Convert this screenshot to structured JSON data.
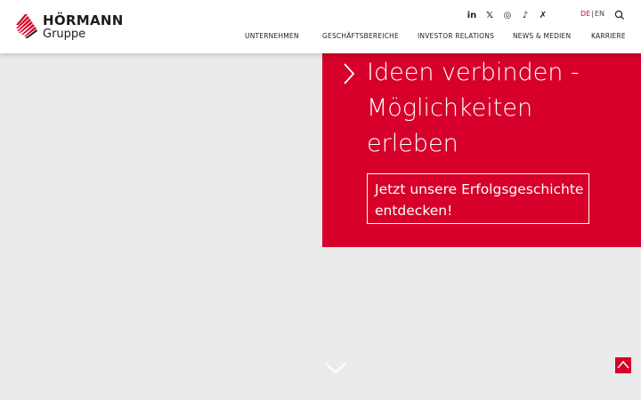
{
  "brand": {
    "name": "HÖRMANN",
    "sub": "Gruppe",
    "accent": "#d6002a"
  },
  "social": [
    {
      "name": "linkedin",
      "glyph": "in"
    },
    {
      "name": "x",
      "glyph": "𝕏"
    },
    {
      "name": "instagram",
      "glyph": "◎"
    },
    {
      "name": "tiktok",
      "glyph": "♪"
    },
    {
      "name": "xing",
      "glyph": "✗"
    }
  ],
  "lang": {
    "active": "DE",
    "sep": "|",
    "other": "EN"
  },
  "nav": [
    "UNTERNEHMEN",
    "GESCHÄFTSBEREICHE",
    "INVESTOR RELATIONS",
    "NEWS & MEDIEN",
    "KARRIERE"
  ],
  "hero": {
    "title_lines": [
      "Ideen verbinden -",
      "Möglichkeiten",
      "erleben"
    ],
    "cta_lines": [
      "Jetzt unsere Erfolgsgeschichte",
      "entdecken!"
    ]
  },
  "colors": {
    "header_bg": "#ffffff",
    "page_bg": "#ebebeb",
    "hero_bg": "#d6002a"
  }
}
